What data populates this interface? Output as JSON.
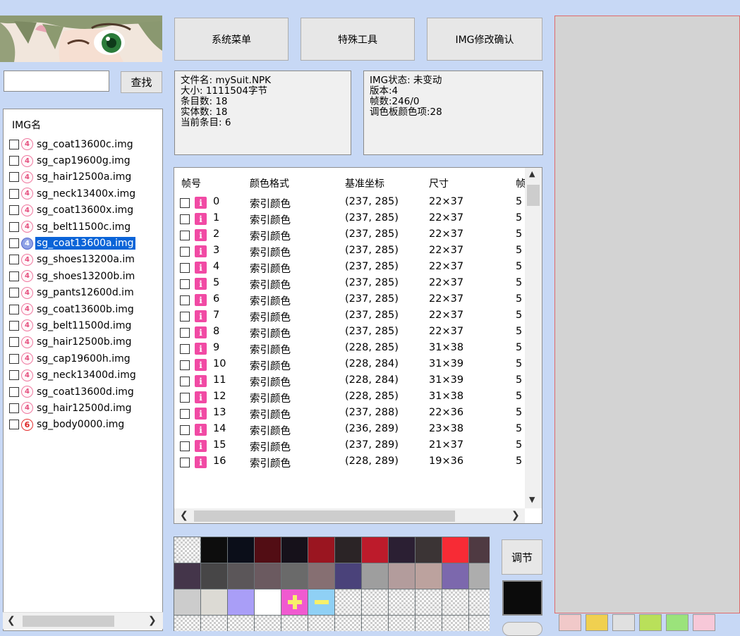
{
  "search": {
    "value": "",
    "button": "查找"
  },
  "img_list": {
    "header": "IMG名",
    "items": [
      {
        "name": "sg_coat13600c.img",
        "version": "4",
        "selected": false
      },
      {
        "name": "sg_cap19600g.img",
        "version": "4",
        "selected": false
      },
      {
        "name": "sg_hair12500a.img",
        "version": "4",
        "selected": false
      },
      {
        "name": "sg_neck13400x.img",
        "version": "4",
        "selected": false
      },
      {
        "name": "sg_coat13600x.img",
        "version": "4",
        "selected": false
      },
      {
        "name": "sg_belt11500c.img",
        "version": "4",
        "selected": false
      },
      {
        "name": "sg_coat13600a.img",
        "version": "4",
        "selected": true
      },
      {
        "name": "sg_shoes13200a.im",
        "version": "4",
        "selected": false
      },
      {
        "name": "sg_shoes13200b.im",
        "version": "4",
        "selected": false
      },
      {
        "name": "sg_pants12600d.im",
        "version": "4",
        "selected": false
      },
      {
        "name": "sg_coat13600b.img",
        "version": "4",
        "selected": false
      },
      {
        "name": "sg_belt11500d.img",
        "version": "4",
        "selected": false
      },
      {
        "name": "sg_hair12500b.img",
        "version": "4",
        "selected": false
      },
      {
        "name": "sg_cap19600h.img",
        "version": "4",
        "selected": false
      },
      {
        "name": "sg_neck13400d.img",
        "version": "4",
        "selected": false
      },
      {
        "name": "sg_coat13600d.img",
        "version": "4",
        "selected": false
      },
      {
        "name": "sg_hair12500d.img",
        "version": "4",
        "selected": false
      },
      {
        "name": "sg_body0000.img",
        "version": "6",
        "selected": false
      }
    ]
  },
  "toolbar": {
    "system_menu": "系统菜单",
    "special_tools": "特殊工具",
    "img_confirm": "IMG修改确认"
  },
  "file_info": {
    "filename": "文件名: mySuit.NPK",
    "size": "大小: 1111504字节",
    "entries": "条目数: 18",
    "entities": "实体数: 18",
    "current": "当前条目: 6"
  },
  "img_status": {
    "state": "IMG状态: 未变动",
    "version": "版本:4",
    "frames": "帧数:246/0",
    "palette": "调色板颜色项:28"
  },
  "frame_table": {
    "columns": [
      "帧号",
      "颜色格式",
      "基准坐标",
      "尺寸",
      "帧"
    ],
    "rows": [
      {
        "idx": "0",
        "format": "索引颜色",
        "coord": "(237, 285)",
        "size": "22×37",
        "extra": "5"
      },
      {
        "idx": "1",
        "format": "索引颜色",
        "coord": "(237, 285)",
        "size": "22×37",
        "extra": "5"
      },
      {
        "idx": "2",
        "format": "索引颜色",
        "coord": "(237, 285)",
        "size": "22×37",
        "extra": "5"
      },
      {
        "idx": "3",
        "format": "索引颜色",
        "coord": "(237, 285)",
        "size": "22×37",
        "extra": "5"
      },
      {
        "idx": "4",
        "format": "索引颜色",
        "coord": "(237, 285)",
        "size": "22×37",
        "extra": "5"
      },
      {
        "idx": "5",
        "format": "索引颜色",
        "coord": "(237, 285)",
        "size": "22×37",
        "extra": "5"
      },
      {
        "idx": "6",
        "format": "索引颜色",
        "coord": "(237, 285)",
        "size": "22×37",
        "extra": "5"
      },
      {
        "idx": "7",
        "format": "索引颜色",
        "coord": "(237, 285)",
        "size": "22×37",
        "extra": "5"
      },
      {
        "idx": "8",
        "format": "索引颜色",
        "coord": "(237, 285)",
        "size": "22×37",
        "extra": "5"
      },
      {
        "idx": "9",
        "format": "索引颜色",
        "coord": "(228, 285)",
        "size": "31×38",
        "extra": "5"
      },
      {
        "idx": "10",
        "format": "索引颜色",
        "coord": "(228, 284)",
        "size": "31×39",
        "extra": "5"
      },
      {
        "idx": "11",
        "format": "索引颜色",
        "coord": "(228, 284)",
        "size": "31×39",
        "extra": "5"
      },
      {
        "idx": "12",
        "format": "索引颜色",
        "coord": "(228, 285)",
        "size": "31×38",
        "extra": "5"
      },
      {
        "idx": "13",
        "format": "索引颜色",
        "coord": "(237, 288)",
        "size": "22×36",
        "extra": "5"
      },
      {
        "idx": "14",
        "format": "索引颜色",
        "coord": "(236, 289)",
        "size": "23×38",
        "extra": "5"
      },
      {
        "idx": "15",
        "format": "索引颜色",
        "coord": "(237, 289)",
        "size": "21×37",
        "extra": "5"
      },
      {
        "idx": "16",
        "format": "索引颜色",
        "coord": "(228, 289)",
        "size": "19×36",
        "extra": "5"
      }
    ]
  },
  "palette": {
    "adjust_button": "调节",
    "current_color": "#0b0b0b",
    "colors": [
      "transparent",
      "#0d0d0d",
      "#0b0e19",
      "#520d14",
      "#16111a",
      "#9a1520",
      "#2b2426",
      "#bd1b2b",
      "#2b1f33",
      "#3b3435",
      "#f72b35",
      "#4f3a42",
      "#44354a",
      "#474647",
      "#5b5659",
      "#6b5a60",
      "#6a6a6a",
      "#866f72",
      "#4a427a",
      "#9e9e9e",
      "#b39c9c",
      "#bca29e",
      "#7c68ad",
      "#adadad",
      "#cccccc",
      "#dcdad4",
      "#a99ef7",
      "#ffffff",
      "plus",
      "minus",
      "transparent",
      "transparent",
      "transparent",
      "transparent",
      "transparent",
      "transparent",
      "transparent",
      "transparent",
      "transparent",
      "transparent",
      "transparent",
      "transparent",
      "transparent",
      "transparent",
      "transparent",
      "transparent",
      "transparent",
      "transparent"
    ]
  },
  "tools": [
    "grid-icon",
    "color-bars-icon",
    "film-icon",
    "cat-icon",
    "frog-icon",
    "paw-icon"
  ]
}
